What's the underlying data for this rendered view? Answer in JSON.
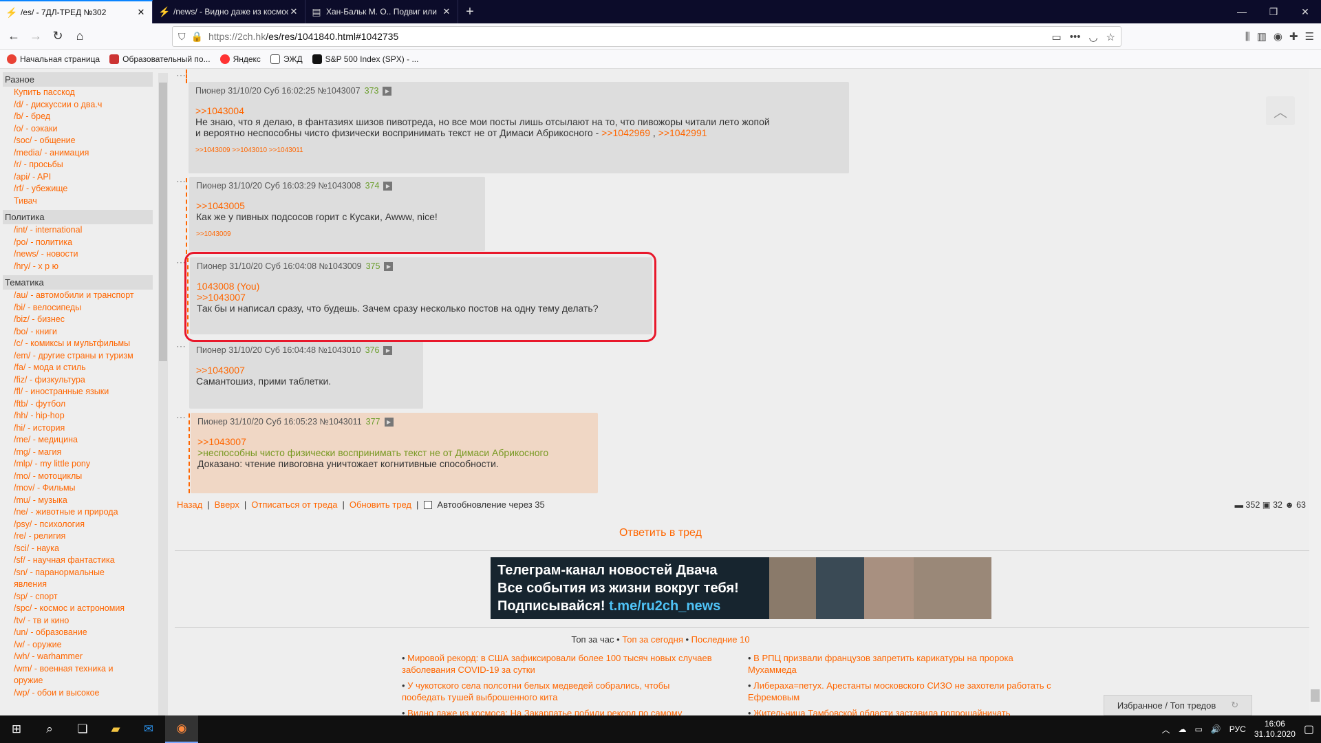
{
  "tabs": [
    {
      "title": "/es/ - 7ДЛ-ТРЕД №302",
      "active": true
    },
    {
      "title": "/news/ - Видно даже из космоса",
      "active": false
    },
    {
      "title": "Хан-Бальк М. О.. Подвиг или",
      "active": false
    }
  ],
  "address": {
    "prefix": "https://2ch.hk",
    "path": "/es/res/1041840.html#1042735"
  },
  "bookmarks": [
    "Начальная страница",
    "Образовательный по...",
    "Яндекс",
    "ЭЖД",
    "S&P 500 Index (SPX) - ..."
  ],
  "sidebar": {
    "sections": [
      {
        "title": "Разное",
        "items": [
          "Купить пасскод",
          "/d/ - дискуссии о два.ч",
          "/b/ - бред",
          "/o/ - оэкаки",
          "/soc/ - общение",
          "/media/ - анимация",
          "/r/ - просьбы",
          "/api/ - API",
          "/rf/ - убежище",
          "Тивач"
        ]
      },
      {
        "title": "Политика",
        "items": [
          "/int/ - international",
          "/po/ - политика",
          "/news/ - новости",
          "/hry/ - х р ю"
        ]
      },
      {
        "title": "Тематика",
        "items": [
          "/au/ - автомобили и транспорт",
          "/bi/ - велосипеды",
          "/biz/ - бизнес",
          "/bo/ - книги",
          "/c/ - комиксы и мультфильмы",
          "/em/ - другие страны и туризм",
          "/fa/ - мода и стиль",
          "/fiz/ - физкультура",
          "/fl/ - иностранные языки",
          "/ftb/ - футбол",
          "/hh/ - hip-hop",
          "/hi/ - история",
          "/me/ - медицина",
          "/mg/ - магия",
          "/mlp/ - my little pony",
          "/mo/ - мотоциклы",
          "/mov/ - Фильмы",
          "/mu/ - музыка",
          "/ne/ - животные и природа",
          "/psy/ - психология",
          "/re/ - религия",
          "/sci/ - наука",
          "/sf/ - научная фантастика",
          "/sn/ - паранормальные",
          "явления",
          "/sp/ - спорт",
          "/spc/ - космос и астрономия",
          "/tv/ - тв и кино",
          "/un/ - образование",
          "/w/ - оружие",
          "/wh/ - warhammer",
          "/wm/ - военная техника и",
          "оружие",
          "/wp/ - обои и высокое"
        ]
      }
    ]
  },
  "posts": [
    {
      "head": "Пионер 31/10/20 Суб 16:02:25  №1043007",
      "num": "373",
      "quote": ">>1043004",
      "text": "Не знаю, что я делаю, в фантазиях шизов пивотреда, но все мои посты лишь отсылают на то, что пивожоры читали лето жопой",
      "text2": "и вероятно неспособны чисто физически воспринимать текст не от Димаси Абрикосного -",
      "l1": ">>1042969",
      "comma": ",",
      "l2": ">>1042991",
      "refs": ">>1043009 >>1043010 >>1043011"
    },
    {
      "head": "Пионер 31/10/20 Суб 16:03:29  №1043008",
      "num": "374",
      "quote": ">>1043005",
      "text": "Как же у пивных подсосов горит с Кусаки, Awww, nice!",
      "refs": ">>1043009"
    },
    {
      "head": "Пионер 31/10/20 Суб 16:04:08  №1043009",
      "num": "375",
      "quote0": "1043008 (You)",
      "quote": ">>1043007",
      "text": "Так бы и написал сразу, что будешь. Зачем сразу несколько постов на одну тему делать?"
    },
    {
      "head": "Пионер 31/10/20 Суб 16:04:48  №1043010",
      "num": "376",
      "quote": ">>1043007",
      "text": "Самантошиз, прими таблетки."
    },
    {
      "head": "Пионер 31/10/20 Суб 16:05:23  №1043011",
      "num": "377",
      "quote": ">>1043007",
      "green": ">неспособны чисто физически воспринимать текст не от Димаси Абрикосного",
      "text": "Доказано: чтение пивоговна уничтожает когнитивные способности."
    }
  ],
  "bottomnav": {
    "back": "Назад",
    "top": "Вверх",
    "unsub": "Отписаться от треда",
    "refresh": "Обновить тред",
    "auto": "Автообновление через 35"
  },
  "stats": {
    "posts": "352",
    "images": "32",
    "users": "63"
  },
  "reply": "Ответить в тред",
  "banner": {
    "l1": "Телеграм-канал новостей Двача",
    "l2": "Все события из жизни вокруг тебя!",
    "l3a": "Подписывайся!",
    "l3b": "t.me/ru2ch_news"
  },
  "topnav": {
    "a": "Топ за час",
    "b": "Топ за сегодня",
    "c": "Последние 10"
  },
  "news": [
    "Мировой рекорд: в США зафиксировали более 100 тысяч новых случаев",
    "заболевания COVID-19 за сутки",
    "В РПЦ призвали французов запретить карикатуры на пророка",
    "Мухаммеда",
    "У чукотского села полсотни белых медведей собрались, чтобы",
    "пообедать тушей выброшенного кита",
    "Либераха=петух. Арестанты московского СИЗО не захотели работать с",
    "Ефремовым",
    "Видно даже из космоса: На Закарпатье побили рекорд по самому",
    "Жительница Тамбовской области заставила попрошайничать"
  ],
  "favpanel": "Избранное / Топ тредов",
  "taskbar": {
    "lang": "РУС",
    "time": "16:06",
    "date": "31.10.2020"
  }
}
